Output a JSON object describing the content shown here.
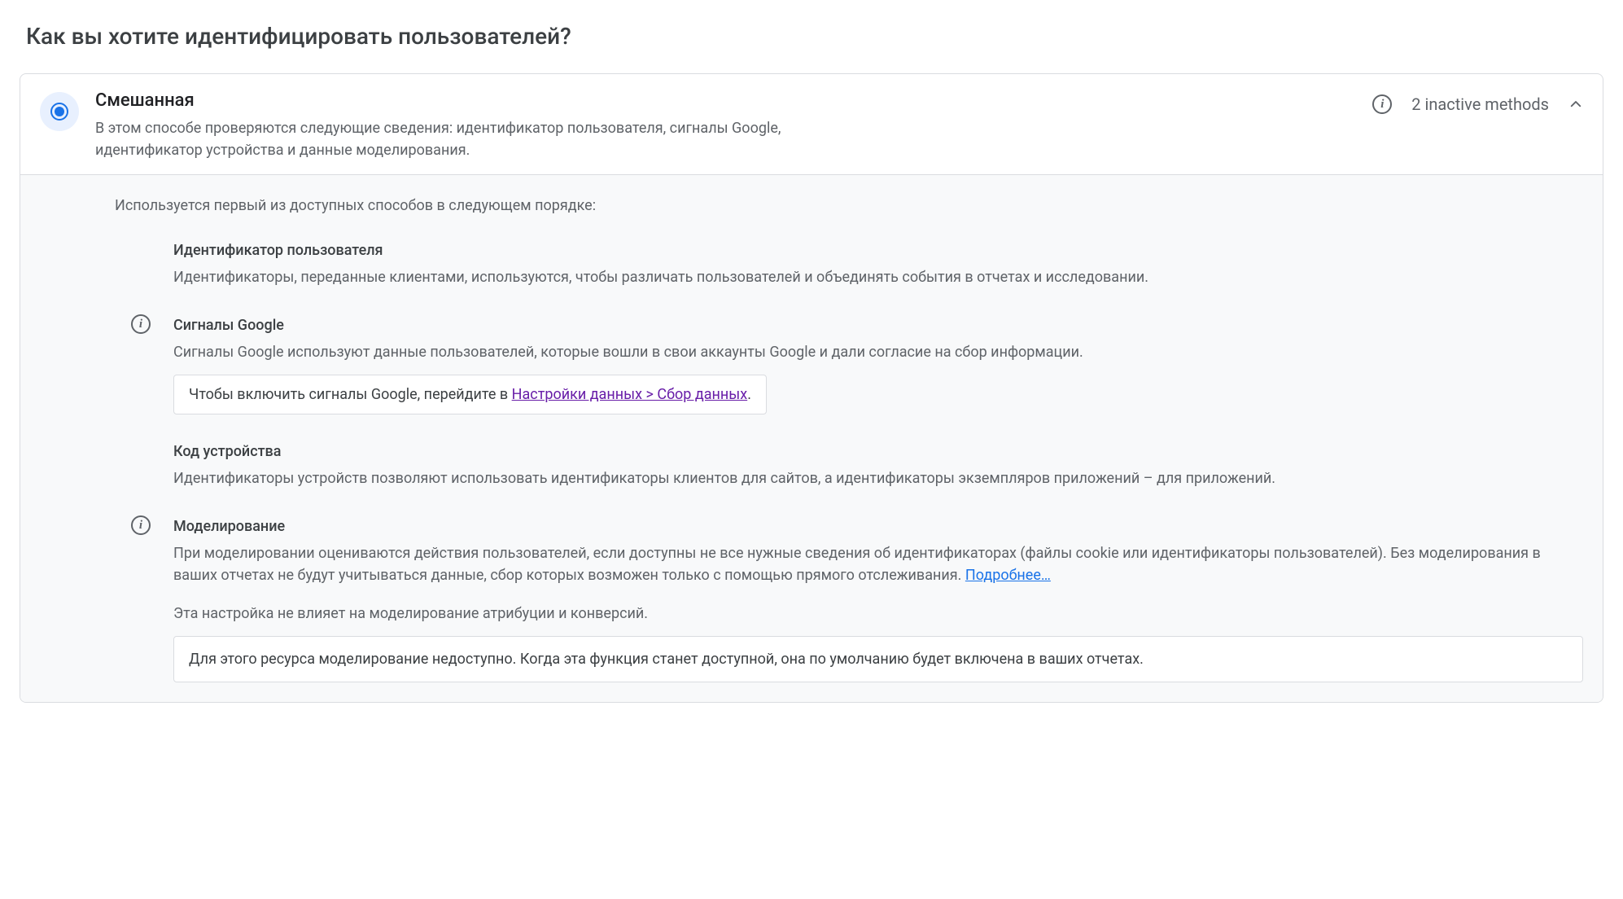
{
  "page": {
    "title": "Как вы хотите идентифицировать пользователей?"
  },
  "card": {
    "title": "Смешанная",
    "subtitle": "В этом способе проверяются следующие сведения: идентификатор пользователя, сигналы Google, идентификатор устройства и данные моделирования.",
    "inactive_label": "2 inactive methods"
  },
  "body": {
    "intro": "Используется первый из доступных способов в следующем порядке:"
  },
  "methods": {
    "user_id": {
      "title": "Идентификатор пользователя",
      "desc": "Идентификаторы, переданные клиентами, используются, чтобы различать пользователей и объединять события в отчетах и исследовании."
    },
    "signals": {
      "title": "Сигналы Google",
      "desc": "Сигналы Google используют данные пользователей, которые вошли в свои аккаунты Google и дали согласие на сбор информации.",
      "callout_prefix": "Чтобы включить сигналы Google, перейдите в ",
      "callout_link": "Настройки данных > Сбор данных",
      "callout_suffix": "."
    },
    "device": {
      "title": "Код устройства",
      "desc": "Идентификаторы устройств позволяют использовать идентификаторы клиентов для сайтов, а идентификаторы экземпляров приложений – для приложений."
    },
    "modeling": {
      "title": "Моделирование",
      "desc_prefix": "При моделировании оцениваются действия пользователей, если доступны не все нужные сведения об идентификаторах (файлы cookie или идентификаторы пользователей). Без моделирования в ваших отчетах не будут учитываться данные, сбор которых возможен только с помощью прямого отслеживания. ",
      "more_link": "Подробнее…",
      "note": "Эта настройка не влияет на моделирование атрибуции и конверсий.",
      "callout": "Для этого ресурса моделирование недоступно. Когда эта функция станет доступной, она по умолчанию будет включена в ваших отчетах."
    }
  }
}
